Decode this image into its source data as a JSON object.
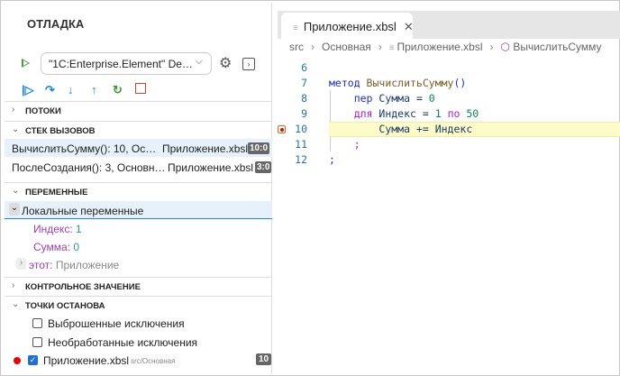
{
  "debug_panel": {
    "title": "ОТЛАДКА",
    "config_select": "\"1C:Enterprise.Element\" De…",
    "sections": {
      "threads": "ПОТОКИ",
      "callstack": "СТЕК ВЫЗОВОВ",
      "variables": "ПЕРЕМЕННЫЕ",
      "watch": "КОНТРОЛЬНОЕ ЗНАЧЕНИЕ",
      "breakpoints": "ТОЧКИ ОСТАНОВА"
    },
    "callstack": [
      {
        "func": "ВычислитьСумму(): 10, Ос…",
        "file": "Приложение.xbsl",
        "pos": "10:0"
      },
      {
        "func": "ПослеСоздания(): 3, Основн…",
        "file": "Приложение.xbsl",
        "pos": "3:0"
      }
    ],
    "variables": {
      "group": "Локальные переменные",
      "items": [
        {
          "name": "Индекс",
          "value": "1"
        },
        {
          "name": "Сумма",
          "value": "0"
        }
      ],
      "this_name": "этот",
      "this_value": "Приложение"
    },
    "breakpoints": [
      {
        "label": "Выброшенные исключения",
        "checked": false
      },
      {
        "label": "Необработанные исключения",
        "checked": false
      },
      {
        "label": "Приложение.xbsl",
        "path": "src/Основная",
        "line": "10",
        "checked": true
      }
    ]
  },
  "editor": {
    "tab": "Приложение.xbsl",
    "breadcrumb": [
      "src",
      "Основная",
      "Приложение.xbsl",
      "ВычислитьСумму"
    ],
    "line_numbers": [
      "6",
      "7",
      "8",
      "9",
      "10",
      "11",
      "12"
    ],
    "code": {
      "l7a": "метод",
      "l7b": " ВычислитьСумму",
      "l7c": "()",
      "l8a": "пер",
      "l8b": " Сумма = ",
      "l8c": "0",
      "l9a": "для",
      "l9b": " Индекс = ",
      "l9c": "1",
      "l9d": " по ",
      "l9e": "50",
      "l10": "Сумма += Индекс",
      "l11": ";",
      "l12": ";"
    }
  }
}
